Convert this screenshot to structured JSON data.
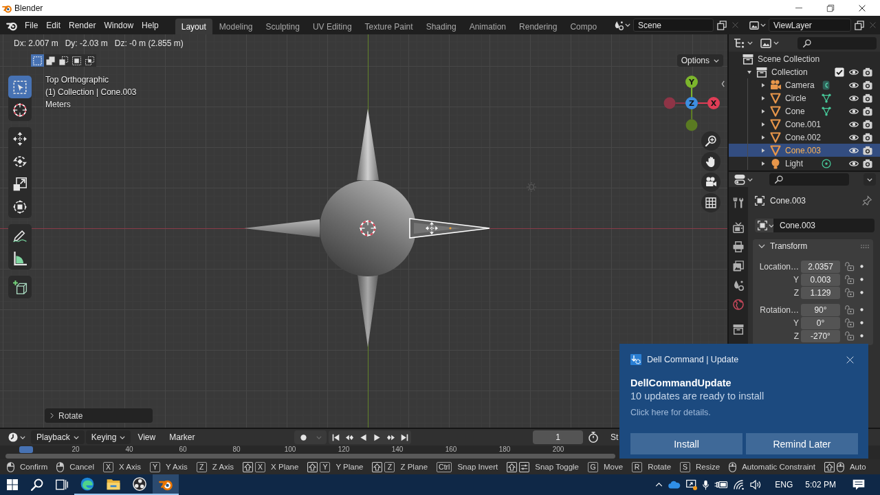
{
  "window": {
    "title": "Blender"
  },
  "menu": [
    "File",
    "Edit",
    "Render",
    "Window",
    "Help"
  ],
  "workspaces": [
    {
      "label": "Layout",
      "selected": true
    },
    {
      "label": "Modeling",
      "selected": false
    },
    {
      "label": "Sculpting",
      "selected": false
    },
    {
      "label": "UV Editing",
      "selected": false
    },
    {
      "label": "Texture Paint",
      "selected": false
    },
    {
      "label": "Shading",
      "selected": false
    },
    {
      "label": "Animation",
      "selected": false
    },
    {
      "label": "Rendering",
      "selected": false
    },
    {
      "label": "Compo",
      "selected": false
    }
  ],
  "scene": "Scene",
  "view_layer": "ViewLayer",
  "viewport": {
    "readout": [
      "Dx: 2.007 m",
      "Dy: -2.03 m",
      "Dz: -0 m (2.855 m)"
    ],
    "select_modes": [
      {
        "kind": "new",
        "selected": true
      },
      {
        "kind": "extend",
        "selected": false
      },
      {
        "kind": "subtract",
        "selected": false
      },
      {
        "kind": "invert",
        "selected": false
      },
      {
        "kind": "intersect",
        "selected": false
      }
    ],
    "options": "Options",
    "overlay": [
      "Top Orthographic",
      "(1) Collection | Cone.003",
      "Meters"
    ],
    "tool_groups": [
      {
        "tools": [
          {
            "kind": "select_box",
            "selected": true
          },
          {
            "kind": "cursor",
            "selected": false
          }
        ]
      },
      {
        "tools": [
          {
            "kind": "move",
            "selected": false
          },
          {
            "kind": "rotate",
            "selected": false
          },
          {
            "kind": "scale",
            "selected": false
          },
          {
            "kind": "transform",
            "selected": false
          }
        ]
      },
      {
        "tools": [
          {
            "kind": "annotate",
            "selected": false
          },
          {
            "kind": "measure",
            "selected": false
          }
        ]
      },
      {
        "tools": [
          {
            "kind": "add_cube",
            "selected": false
          }
        ]
      }
    ],
    "gizmo": [
      {
        "label": "Y",
        "color": "#7cb52c"
      },
      {
        "label": "X",
        "color": "#df3d56"
      },
      {
        "label": "Z",
        "color": "#3e8ee0"
      }
    ],
    "redo_panel": {
      "label": "Rotate",
      "expanded": false
    }
  },
  "outliner": {
    "items": [
      {
        "label": "Scene Collection",
        "kind": "scene_collection",
        "selected": false,
        "children": [
          {
            "label": "Collection",
            "kind": "collection",
            "expanded": true,
            "selected": false,
            "checked": true,
            "visible": true,
            "renderable": true,
            "children": [
              {
                "label": "Camera",
                "kind": "camera",
                "expanded": false,
                "selected": false,
                "show_data": true,
                "visible": true,
                "renderable": true
              },
              {
                "label": "Circle",
                "kind": "mesh",
                "expanded": false,
                "selected": false,
                "show_data": true,
                "visible": true,
                "renderable": true
              },
              {
                "label": "Cone",
                "kind": "mesh",
                "expanded": false,
                "selected": false,
                "show_data": true,
                "visible": true,
                "renderable": true
              },
              {
                "label": "Cone.001",
                "kind": "mesh",
                "expanded": false,
                "selected": false,
                "show_data": false,
                "visible": true,
                "renderable": true
              },
              {
                "label": "Cone.002",
                "kind": "mesh",
                "expanded": false,
                "selected": false,
                "show_data": false,
                "visible": true,
                "renderable": true
              },
              {
                "label": "Cone.003",
                "kind": "mesh",
                "expanded": false,
                "selected": true,
                "show_data": false,
                "visible": true,
                "renderable": true
              },
              {
                "label": "Light",
                "kind": "light",
                "expanded": false,
                "selected": false,
                "show_data": true,
                "visible": true,
                "renderable": true
              }
            ]
          }
        ]
      }
    ]
  },
  "properties": {
    "object": "Cone.003",
    "data": "Cone.003",
    "panel": {
      "title": "Transform",
      "expanded": true,
      "groups": [
        {
          "rows": [
            {
              "label": "Location…",
              "value": "2.0357",
              "locked": false,
              "animated": false
            },
            {
              "label": "Y",
              "value": "0.003",
              "locked": false,
              "animated": false
            },
            {
              "label": "Z",
              "value": "1.129",
              "locked": false,
              "animated": false
            }
          ]
        },
        {
          "rows": [
            {
              "label": "Rotation…",
              "value": "90°",
              "locked": false,
              "animated": false
            },
            {
              "label": "Y",
              "value": "0°",
              "locked": false,
              "animated": false
            },
            {
              "label": "Z",
              "value": "-270°",
              "locked": false,
              "animated": false
            }
          ]
        }
      ]
    }
  },
  "timeline": {
    "menus": [
      {
        "label": "Playback",
        "dropdown": true
      },
      {
        "label": "Keying",
        "dropdown": true
      },
      {
        "label": "View",
        "dropdown": false
      },
      {
        "label": "Marker",
        "dropdown": false
      }
    ],
    "auto_keying": false,
    "frame": "1",
    "start": "St",
    "ruler": [
      "20",
      "40",
      "60",
      "80",
      "100",
      "120",
      "140",
      "160",
      "180",
      "200"
    ]
  },
  "status_bar": [
    {
      "keys": [
        {
          "kind": "mouse_left"
        }
      ],
      "label": "Confirm"
    },
    {
      "keys": [
        {
          "kind": "mouse_right"
        }
      ],
      "label": "Cancel"
    },
    {
      "keys": [
        {
          "kind": "key",
          "label": "X"
        }
      ],
      "label": "X Axis"
    },
    {
      "keys": [
        {
          "kind": "key",
          "label": "Y"
        }
      ],
      "label": "Y Axis"
    },
    {
      "keys": [
        {
          "kind": "key",
          "label": "Z"
        }
      ],
      "label": "Z Axis"
    },
    {
      "keys": [
        {
          "kind": "shift"
        },
        {
          "kind": "key",
          "label": "X"
        }
      ],
      "label": "X Plane"
    },
    {
      "keys": [
        {
          "kind": "shift"
        },
        {
          "kind": "key",
          "label": "Y"
        }
      ],
      "label": "Y Plane"
    },
    {
      "keys": [
        {
          "kind": "shift"
        },
        {
          "kind": "key",
          "label": "Z"
        }
      ],
      "label": "Z Plane"
    },
    {
      "keys": [
        {
          "kind": "key",
          "label": "Ctrl"
        }
      ],
      "label": "Snap Invert"
    },
    {
      "keys": [
        {
          "kind": "shift"
        },
        {
          "kind": "snap"
        }
      ],
      "label": "Snap Toggle"
    },
    {
      "keys": [
        {
          "kind": "key",
          "label": "G"
        }
      ],
      "label": "Move"
    },
    {
      "keys": [
        {
          "kind": "key",
          "label": "R"
        }
      ],
      "label": "Rotate"
    },
    {
      "keys": [
        {
          "kind": "key",
          "label": "S"
        }
      ],
      "label": "Resize"
    },
    {
      "keys": [
        {
          "kind": "mouse_middle"
        }
      ],
      "label": "Automatic Constraint"
    },
    {
      "keys": [
        {
          "kind": "shift"
        },
        {
          "kind": "mouse_middle"
        }
      ],
      "label": "Auto"
    }
  ],
  "notification": {
    "app": "Dell Command | Update",
    "title": "DellCommandUpdate",
    "message": "10 updates are ready to install",
    "hint": "Click here for details.",
    "buttons": [
      "Install",
      "Remind Later"
    ]
  },
  "taskbar": {
    "apps": [
      {
        "running": true,
        "selected": false
      },
      {
        "running": true,
        "selected": false
      },
      {
        "running": true,
        "selected": false
      },
      {
        "running": true,
        "selected": true
      }
    ],
    "language": "ENG",
    "time": "5:02 PM"
  }
}
